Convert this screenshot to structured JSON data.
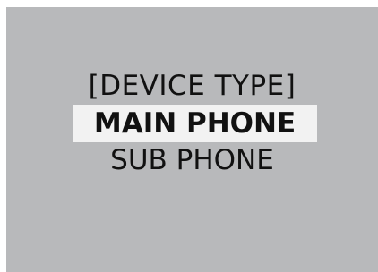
{
  "screen": {
    "background_color": "#b8b9bb",
    "title": "[DEVICE TYPE]",
    "menu": [
      {
        "label": "MAIN PHONE",
        "selected": true,
        "highlight_color": "#f2f2f2"
      },
      {
        "label": "SUB PHONE",
        "selected": false
      }
    ]
  }
}
